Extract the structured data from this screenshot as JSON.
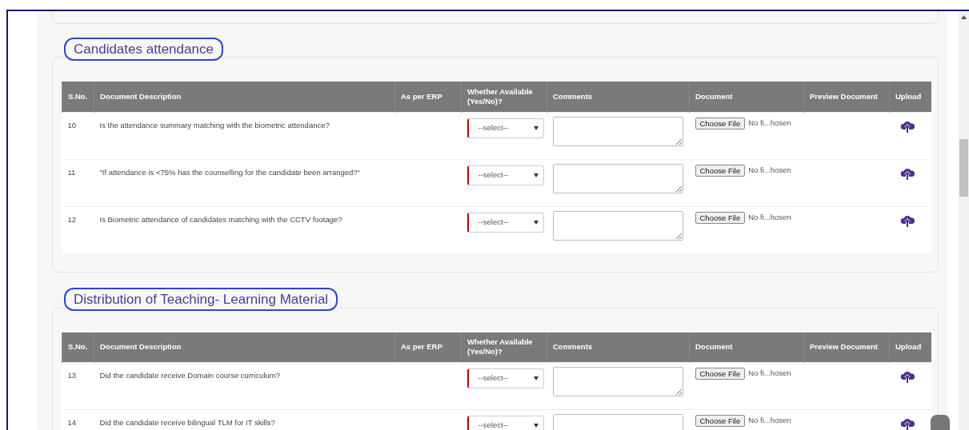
{
  "sections": [
    {
      "title": "Candidates attendance",
      "columns": [
        "S.No.",
        "Document Description",
        "As per ERP",
        "Whether Available (Yes/No)?",
        "Comments",
        "Document",
        "Preview Document",
        "Upload"
      ],
      "rows": [
        {
          "sno": "10",
          "description": "Is the attendance summary matching with the biometric attendance?",
          "select": "--select--",
          "file_button": "Choose File",
          "file_status": "No fi...hosen"
        },
        {
          "sno": "11",
          "description": "\"If attendance is <75% has the counselling for the candidate been arranged?\"",
          "select": "--select--",
          "file_button": "Choose File",
          "file_status": "No fi...hosen"
        },
        {
          "sno": "12",
          "description": "Is Biometric attendance of candidates matching with the CCTV footage?",
          "select": "--select--",
          "file_button": "Choose File",
          "file_status": "No fi...hosen"
        }
      ]
    },
    {
      "title": "Distribution of Teaching- Learning Material",
      "columns": [
        "S.No.",
        "Document Description",
        "As per ERP",
        "Whether Available (Yes/No)?",
        "Comments",
        "Document",
        "Preview Document",
        "Upload"
      ],
      "rows": [
        {
          "sno": "13",
          "description": "Did the candidate receive Domain course curriculum?",
          "select": "--select--",
          "file_button": "Choose File",
          "file_status": "No fi...hosen"
        },
        {
          "sno": "14",
          "description": "Did the candidate receive bilingual TLM for IT skills?",
          "select": "--select--",
          "file_button": "Choose File",
          "file_status": "No fi...hosen"
        }
      ]
    }
  ]
}
